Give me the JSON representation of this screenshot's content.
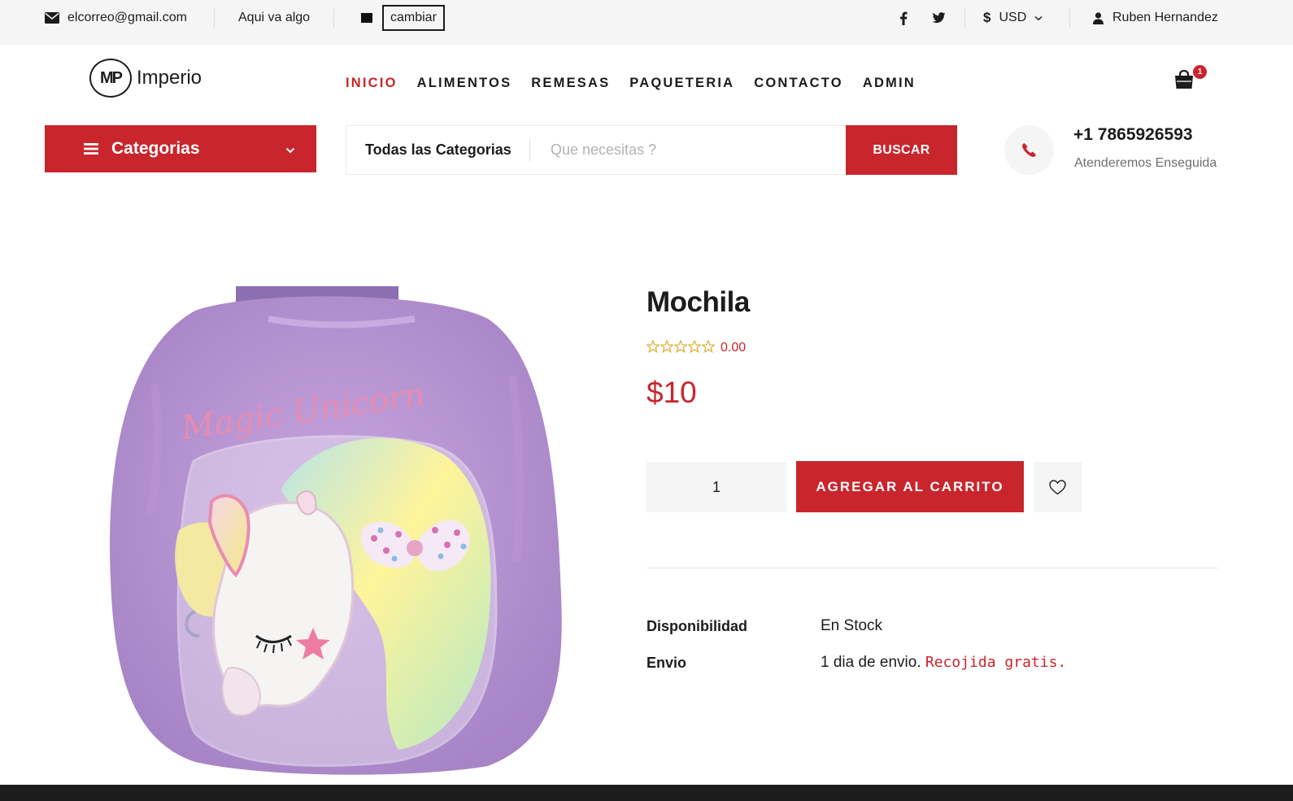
{
  "topbar": {
    "email": "elcorreo@gmail.com",
    "tagline": "Aqui va algo",
    "change_button": "cambiar",
    "currency_symbol": "$",
    "currency": "USD",
    "user_name": "Ruben Hernandez",
    "icons": [
      "mail-icon",
      "flag-icon",
      "facebook-icon",
      "twitter-icon",
      "chevron-down-icon",
      "user-icon"
    ]
  },
  "header": {
    "logo_mark": "MP",
    "logo_text": "Imperio",
    "nav": [
      {
        "label": "INICIO",
        "active": true
      },
      {
        "label": "ALIMENTOS",
        "active": false
      },
      {
        "label": "REMESAS",
        "active": false
      },
      {
        "label": "PAQUETERIA",
        "active": false
      },
      {
        "label": "CONTACTO",
        "active": false
      },
      {
        "label": "ADMIN",
        "active": false
      }
    ],
    "cart_count": "1"
  },
  "search_row": {
    "categories_label": "Categorias",
    "search_category": "Todas las Categorias",
    "search_placeholder": "Que necesitas ?",
    "search_button": "BUSCAR",
    "phone": "+1 7865926593",
    "phone_caption": "Atenderemos Enseguida"
  },
  "product": {
    "title": "Mochila",
    "rating": "0.00",
    "stars_filled": 0,
    "stars_total": 5,
    "price": "$10",
    "quantity": "1",
    "add_to_cart": "AGREGAR AL CARRITO",
    "specs": {
      "availability_label": "Disponibilidad",
      "availability_value": "En Stock",
      "shipping_label": "Envio",
      "shipping_value": "1 dia de envio.",
      "shipping_highlight": "Recojida gratis."
    }
  },
  "colors": {
    "accent": "#c9252c",
    "topbar_bg": "#f5f5f5",
    "text": "#1c1c1c",
    "muted": "#6f6f6f",
    "star": "#e0b13c"
  }
}
